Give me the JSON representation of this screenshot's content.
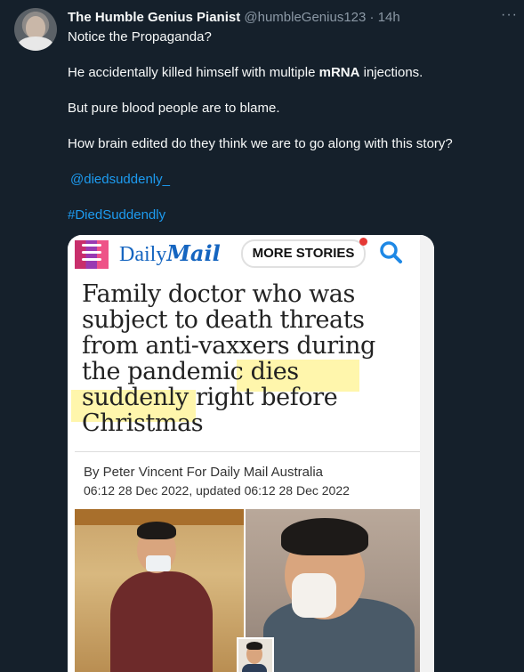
{
  "tweet": {
    "author_name": "The Humble Genius Pianist",
    "author_handle": "@humbleGenius123",
    "separator": "·",
    "time": "14h",
    "more_icon": "more-horizontal-icon",
    "lines": [
      "Notice the Propaganda?",
      "He accidentally killed himself with multiple",
      "mRNA",
      "injections.",
      "But pure blood people are to blame.",
      "How brain edited do they think we are to go along with this story?"
    ],
    "mention": "@diedsuddenly_",
    "hashtag": "#DiedSuddendly"
  },
  "media": {
    "brand_prefix": "Daily",
    "brand_suffix": "Mail",
    "more_stories": "MORE STORIES",
    "headline_lines": [
      "Family doctor who was",
      "subject to death threats",
      "from anti-vaxxers during",
      "the pandemic dies",
      "suddenly right before",
      "Christmas"
    ],
    "byline": "By Peter Vincent For Daily Mail Australia",
    "dateline": "06:12 28 Dec 2022, updated 06:12 28 Dec 2022",
    "colors": {
      "brand": "#1565c0",
      "highlight": "#fff59d",
      "link": "#1d9bf0"
    }
  }
}
